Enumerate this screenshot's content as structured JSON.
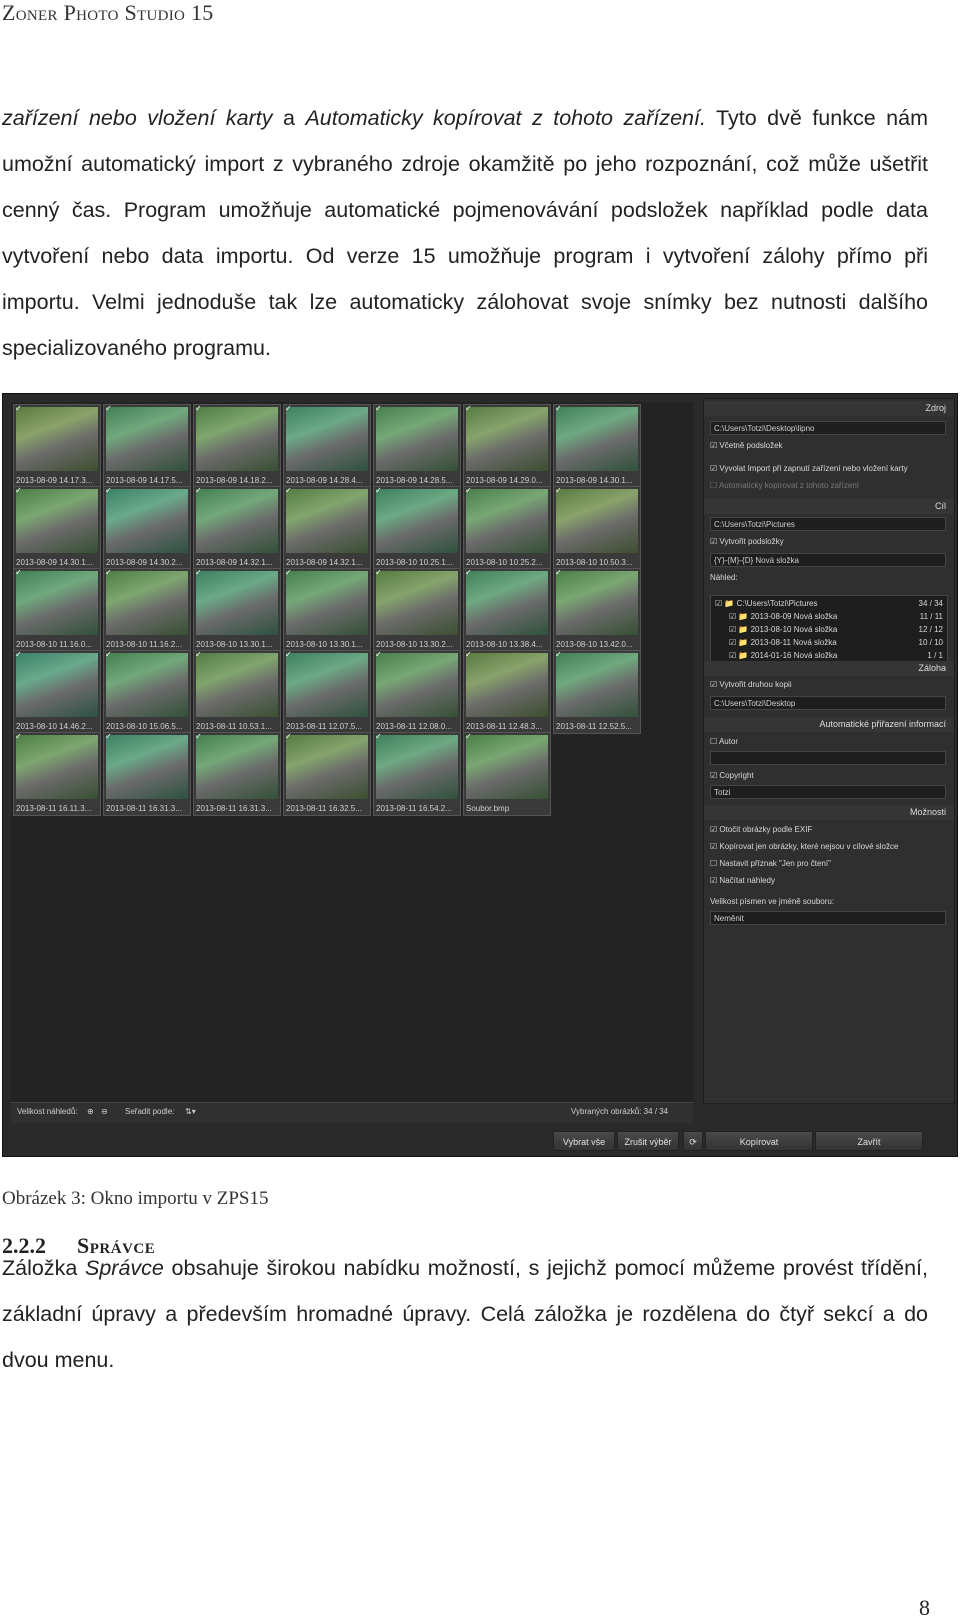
{
  "header": {
    "title": "Zoner Photo Studio 15"
  },
  "paragraph1": {
    "a_italic": "zařízení nebo vložení karty",
    "b": " a ",
    "c_italic": "Automaticky kopírovat z tohoto zařízení.",
    "d": " Tyto dvě funkce nám umožní automatický import z vybraného zdroje okamžitě po jeho rozpoznání, což může ušetřit cenný čas. Program umožňuje automatické pojmenovávání podsložek například podle data vytvoření nebo data importu. Od verze 15 umožňuje program i vytvoření zálohy přímo při importu. Velmi jednoduše tak lze automaticky zálohovat svoje snímky bez nutnosti dalšího specializovaného programu."
  },
  "figure": {
    "thumbnails": [
      "2013-08-09 14.17.3...",
      "2013-08-09 14.17.5...",
      "2013-08-09 14.18.2...",
      "2013-08-09 14.28.4...",
      "2013-08-09 14.28.5...",
      "2013-08-09 14.29.0...",
      "2013-08-09 14.30.1...",
      "2013-08-09 14.30.1...",
      "2013-08-09 14.30.2...",
      "2013-08-09 14.32.1...",
      "2013-08-09 14.32.1...",
      "2013-08-10 10.25.1...",
      "2013-08-10 10.25.2...",
      "2013-08-10 10.50.3...",
      "2013-08-10 11.16.0...",
      "2013-08-10 11.16.2...",
      "2013-08-10 13.30.1...",
      "2013-08-10 13.30.1...",
      "2013-08-10 13.30.2...",
      "2013-08-10 13.38.4...",
      "2013-08-10 13.42.0...",
      "2013-08-10 14.46.2...",
      "2013-08-10 15.06.5...",
      "2013-08-11 10.53.1...",
      "2013-08-11 12.07.5...",
      "2013-08-11 12.08.0...",
      "2013-08-11 12.48.3...",
      "2013-08-11 12.52.5...",
      "2013-08-11 16.11.3...",
      "2013-08-11 16.31.3...",
      "2013-08-11 16.31.3...",
      "2013-08-11 16.32.5...",
      "2013-08-11 16.54.2...",
      "Soubor.bmp"
    ],
    "bottombar": {
      "thumb_size": "Velikost náhledů:",
      "sort_by": "Seřadit podle:",
      "selected": "Vybraných obrázků: 34 / 34"
    },
    "buttons": {
      "select_all": "Vybrat vše",
      "deselect": "Zrušit výběr",
      "copy": "Kopírovat",
      "close": "Zavřít"
    },
    "panel": {
      "source_header": "Zdroj",
      "source_path": "C:\\Users\\Totzi\\Desktop\\lipno",
      "include_subfolders": "Včetně podsložek",
      "import_on_connect": "Vyvolat Import při zapnutí zařízení nebo vložení karty",
      "auto_copy": "Automaticky kopírovat z tohoto zařízení",
      "target_header": "Cíl",
      "target_path": "C:\\Users\\Totzi\\Pictures",
      "create_subfolders": "Vytvořit podsložky",
      "subfolder_pattern": "{Y}-{M}-{D} Nová složka",
      "preview_label": "Náhled:",
      "tree": [
        {
          "name": "C:\\Users\\Totzi\\Pictures",
          "count": "34 / 34"
        },
        {
          "name": "2013-08-09 Nová složka",
          "count": "11 / 11"
        },
        {
          "name": "2013-08-10 Nová složka",
          "count": "12 / 12"
        },
        {
          "name": "2013-08-11 Nová složka",
          "count": "10 / 10"
        },
        {
          "name": "2014-01-16 Nová složka",
          "count": "1 / 1"
        }
      ],
      "backup_header": "Záloha",
      "second_copy": "Vytvořit druhou kopii",
      "backup_path": "C:\\Users\\Totzi\\Desktop",
      "auto_info_header": "Automatické přiřazení informací",
      "author": "Autor",
      "copyright": "Copyright",
      "copyright_value": "Totzi",
      "options_header": "Možnosti",
      "rotate_exif": "Otočit obrázky podle EXIF",
      "copy_only_missing": "Kopírovat jen obrázky, které nejsou v cílové složce",
      "readonly_flag": "Nastavit příznak \"Jen pro čtení\"",
      "load_previews": "Načítat náhledy",
      "letter_case_label": "Velikost písmen ve jméně souboru:",
      "letter_case_value": "Neměnit"
    }
  },
  "caption": "Obrázek 3: Okno importu v ZPS15",
  "section": {
    "number": "2.2.2",
    "title": "Správce"
  },
  "paragraph2": {
    "a": "Záložka ",
    "b_italic": "Správce",
    "c": " obsahuje širokou nabídku možností, s jejichž pomocí můžeme provést třídění, základní úpravy a především hromadné úpravy. Celá záložka je rozdělena do čtyř sekcí a do dvou menu."
  },
  "page_number": "8"
}
